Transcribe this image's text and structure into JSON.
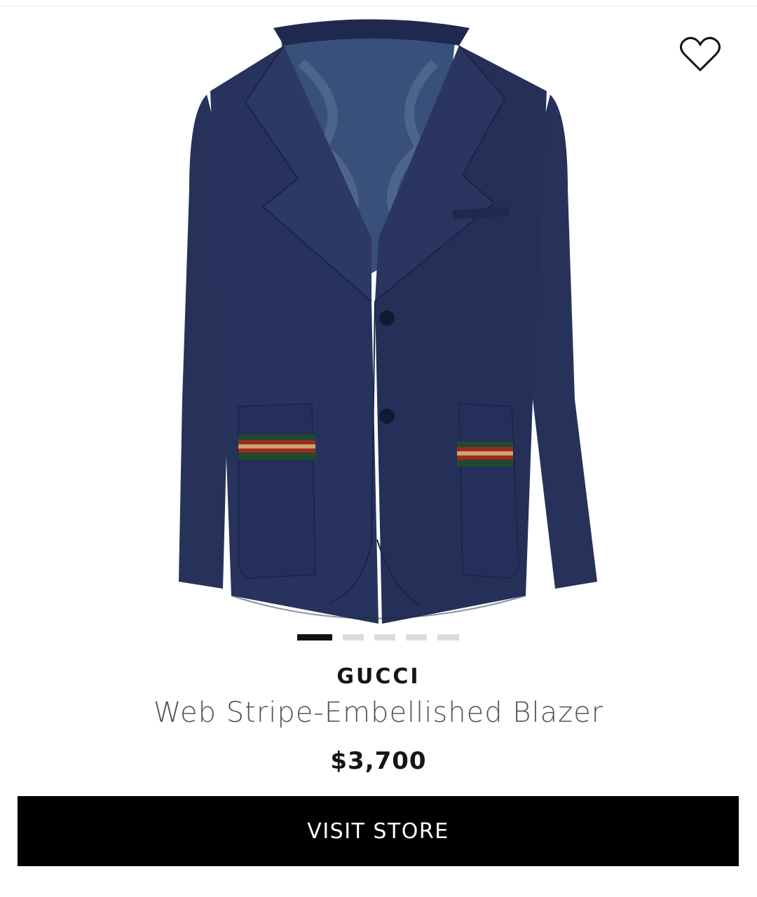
{
  "product": {
    "brand": "GUCCI",
    "name": "Web Stripe-Embellished Blazer",
    "price": "$3,700",
    "image_alt": "Navy blazer with green and red Web stripe pocket details"
  },
  "wishlist": {
    "icon": "heart-outline-icon"
  },
  "carousel": {
    "total": 5,
    "active_index": 0
  },
  "actions": {
    "visit_store_label": "VISIT STORE"
  },
  "colors": {
    "blazer_navy": "#232e55",
    "lining_blue": "#39507a",
    "stripe_green": "#1f4a2e",
    "stripe_red": "#9a2a22",
    "stripe_gold": "#c9a56a",
    "button_bg": "#000000",
    "dot_active": "#111111",
    "dot_inactive": "#dcdcdc"
  }
}
